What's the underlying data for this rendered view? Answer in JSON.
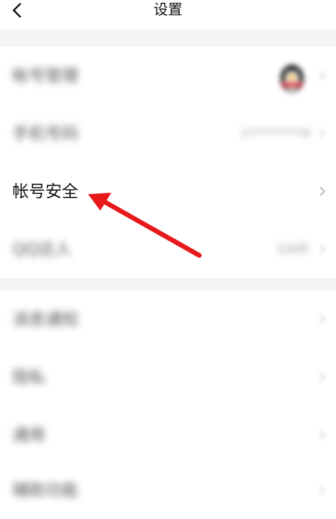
{
  "header": {
    "title": "设置"
  },
  "rows": [
    {
      "label": "帐号管理"
    },
    {
      "label": "手机号码",
      "value": "1**********4"
    },
    {
      "label": "帐号安全"
    },
    {
      "label": "QQ达人",
      "value": "124天"
    },
    {
      "label": "消息通知"
    },
    {
      "label": "隐私"
    },
    {
      "label": "通用"
    },
    {
      "label": "辅助功能"
    }
  ],
  "colors": {
    "background": "#ffffff",
    "section_gap": "#f3f4f6",
    "arrow": "#e8191b"
  },
  "icons": {
    "back": "chevron-left-icon",
    "row": "chevron-right-icon",
    "avatar": "qq-penguin-avatar"
  }
}
